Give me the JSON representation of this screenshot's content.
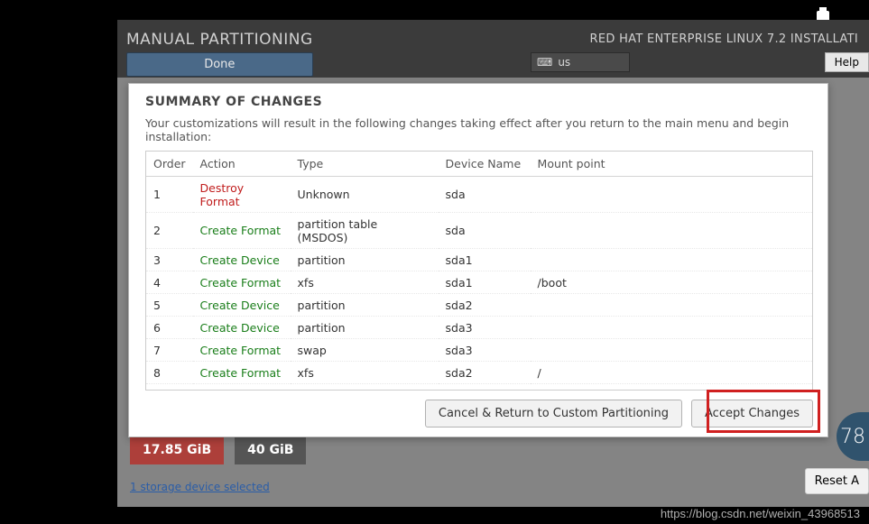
{
  "header": {
    "title": "MANUAL PARTITIONING",
    "subtitle": "RED HAT ENTERPRISE LINUX 7.2 INSTALLATI",
    "done_label": "Done",
    "help_label": "Help",
    "lang_code": "us"
  },
  "summary": {
    "title": "SUMMARY OF CHANGES",
    "description": "Your customizations will result in the following changes taking effect after you return to the main menu and begin installation:",
    "columns": {
      "order": "Order",
      "action": "Action",
      "type": "Type",
      "device": "Device Name",
      "mount": "Mount point"
    },
    "rows": [
      {
        "order": "1",
        "action": "Destroy Format",
        "action_class": "action-destroy",
        "type": "Unknown",
        "device": "sda",
        "mount": ""
      },
      {
        "order": "2",
        "action": "Create Format",
        "action_class": "action-create",
        "type": "partition table (MSDOS)",
        "device": "sda",
        "mount": ""
      },
      {
        "order": "3",
        "action": "Create Device",
        "action_class": "action-create",
        "type": "partition",
        "device": "sda1",
        "mount": ""
      },
      {
        "order": "4",
        "action": "Create Format",
        "action_class": "action-create",
        "type": "xfs",
        "device": "sda1",
        "mount": "/boot"
      },
      {
        "order": "5",
        "action": "Create Device",
        "action_class": "action-create",
        "type": "partition",
        "device": "sda2",
        "mount": ""
      },
      {
        "order": "6",
        "action": "Create Device",
        "action_class": "action-create",
        "type": "partition",
        "device": "sda3",
        "mount": ""
      },
      {
        "order": "7",
        "action": "Create Format",
        "action_class": "action-create",
        "type": "swap",
        "device": "sda3",
        "mount": ""
      },
      {
        "order": "8",
        "action": "Create Format",
        "action_class": "action-create",
        "type": "xfs",
        "device": "sda2",
        "mount": "/"
      }
    ],
    "cancel_label": "Cancel & Return to Custom Partitioning",
    "accept_label": "Accept Changes"
  },
  "bottom": {
    "available_space": "17.85 GiB",
    "total_space": "40 GiB",
    "storage_link": "1 storage device selected",
    "reset_label": "Reset A"
  },
  "side_badge": "78",
  "watermark": "https://blog.csdn.net/weixin_43968513"
}
